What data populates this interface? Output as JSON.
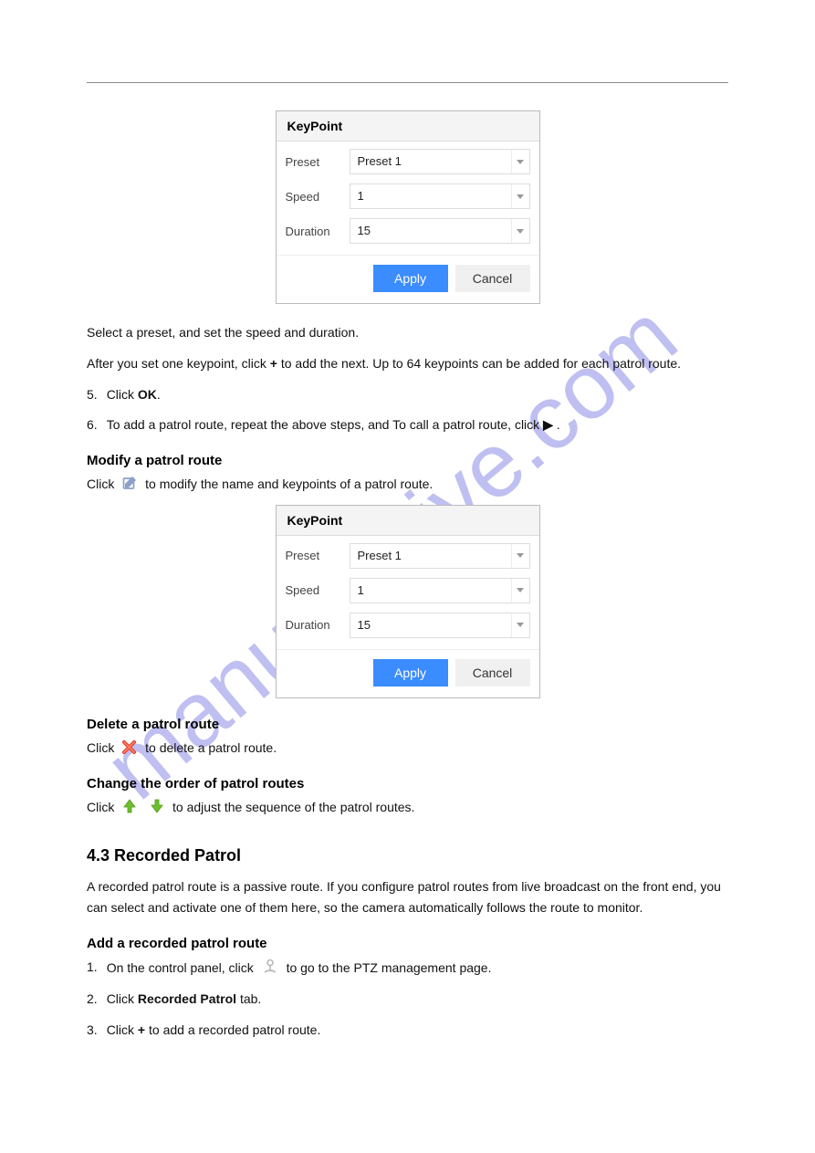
{
  "watermark": "manualshive.com",
  "dialog1": {
    "title": "KeyPoint",
    "fields": {
      "preset_label": "Preset",
      "preset_value": "Preset 1",
      "speed_label": "Speed",
      "speed_value": "1",
      "duration_label": "Duration",
      "duration_value": "15"
    },
    "apply": "Apply",
    "cancel": "Cancel"
  },
  "dialog2": {
    "title": "KeyPoint",
    "fields": {
      "preset_label": "Preset",
      "preset_value": "Preset 1",
      "speed_label": "Speed",
      "speed_value": "1",
      "duration_label": "Duration",
      "duration_value": "15"
    },
    "apply": "Apply",
    "cancel": "Cancel"
  },
  "txt": {
    "t1": "Select a preset, and set the speed and duration.",
    "t2": "After you set one keypoint, click ",
    "t2b": "+",
    "t2c": " to add the next. Up to 64 keypoints can be added for each patrol route.",
    "s5": "5.",
    "s5t": "Click ",
    "s5b": "OK",
    "s5c": ".",
    "s6": "6.",
    "s6t": "To add a patrol route, repeat the above steps, and To call a patrol route, click ",
    "s6b": " ▶ ",
    "s6c": ".",
    "modify_title": "Modify a patrol route",
    "m1": "Click ",
    "m1b": " to modify the name and keypoints of a patrol route.",
    "del_title": "Delete a patrol route",
    "del1": "Click ",
    "del1b": " to delete a patrol route.",
    "order_title": "Change the order of patrol routes",
    "ord1": "Click ",
    "ord1b": " to adjust the sequence of the patrol routes.",
    "recplan_h": "4.3 Recorded Patrol",
    "recplan_p": "A recorded patrol route is a passive route. If you configure patrol routes from live broadcast on the front end, you can select and activate one of them here, so the camera automatically follows the route to monitor.",
    "recplan_add": "Add a recorded patrol route",
    "r1": "1.",
    "r1t": "On the control panel, click ",
    "r1b": " to go to the PTZ management page.",
    "r2": "2.",
    "r2t": "Click ",
    "r2b": "Recorded Patrol",
    "r2c": " tab.",
    "r3": "3.",
    "r3t": "Click ",
    "r3b": "+",
    "r3c": " to add a recorded patrol route."
  }
}
